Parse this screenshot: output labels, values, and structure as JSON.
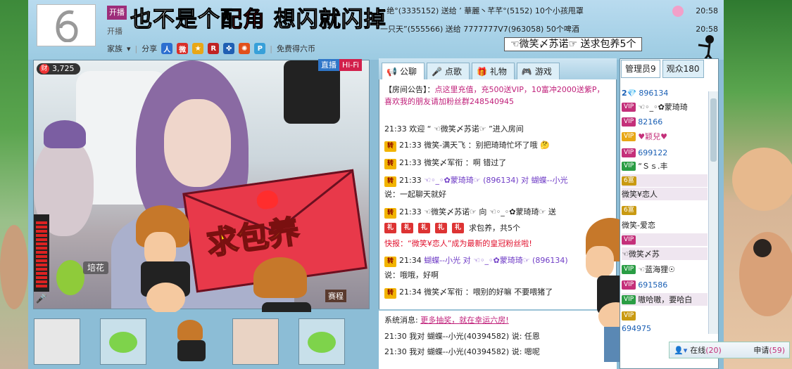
{
  "header": {
    "banner_prefix": "也不是个",
    "banner_red1": "配角",
    "banner_mid": "想闪就闪掉",
    "live_label": "开播",
    "family_label": "家族",
    "share_label": "分享",
    "six_coins_label": "免费得六币"
  },
  "gifts": [
    {
      "text": "−绝°(3335152) 送给 ’ 華麗丶芊芊°(5152) 10个小孩甩罩",
      "time": "20:58"
    },
    {
      "text": "一只天”(555566) 送给 7777777V7(963058) 50个啤酒",
      "time": "20:58"
    }
  ],
  "callout": "☜微笑〆苏诺☞  送求包养5个",
  "video": {
    "wealth_value": "3,725",
    "wealth_badge": "财",
    "live_badge": "直播",
    "hifi_badge": "Hi-Fi",
    "envelope_text": "求包养",
    "flower_label": "培花",
    "match_label": "赛程"
  },
  "chat_tabs": [
    {
      "label": "公聊",
      "icon": "megaphone-icon",
      "active": true
    },
    {
      "label": "点歌",
      "icon": "microphone-icon",
      "active": false
    },
    {
      "label": "礼物",
      "icon": "gift-icon",
      "active": false
    },
    {
      "label": "游戏",
      "icon": "gamepad-icon",
      "active": false
    }
  ],
  "announcement": {
    "prefix": "【房间公告】：",
    "body": "点这里充值，充500送VIP，10富冲2000送紫P，喜欢我的朋友请加粉丝群248540945"
  },
  "chat": [
    {
      "time": "21:33",
      "text": "欢迎 “ ☜微笑〆苏诺☞ ”进入房间",
      "zhuan": false
    },
    {
      "time": "21:33",
      "text": "微笑-满天飞 ：别把琦琦忙坏了哦",
      "zhuan": true
    },
    {
      "time": "21:33",
      "text": "微笑〆军衔 ：啊  错过了",
      "zhuan": true
    },
    {
      "time": "21:33",
      "text": "☜◦_◦✿蒙琦琦☞ (896134) 对 蝴蝶--小光",
      "zhuan": true
    },
    {
      "time": "",
      "text": "说：一起聊天就好",
      "zhuan": false
    },
    {
      "time": "21:33",
      "text": "☜微笑〆苏诺☞ 向 ☜◦_◦✿蒙琦琦☞ 送",
      "zhuan": true
    },
    {
      "time": "",
      "text": "求包养，共5个",
      "zhuan": false
    },
    {
      "time": "",
      "text": "快报：“微笑¥恋人”成为最新的皇冠粉丝啦!",
      "zhuan": false,
      "flash": true
    },
    {
      "time": "21:34",
      "text": "蝴蝶--小光 对 ☜◦_◦✿蒙琦琦☞ (896134)",
      "zhuan": true
    },
    {
      "time": "",
      "text": "说：哦哦，好啊",
      "zhuan": false
    },
    {
      "time": "21:34",
      "text": "微笑〆军衔 ：喂别的好嘛  不要喂猪了",
      "zhuan": true
    }
  ],
  "system": {
    "label": "系统消息:",
    "link": "更多抽奖，就在幸运六房!",
    "lines": [
      "21:30 我对  蝴蝶--小光(40394582) 说: 任恩",
      "21:30 我对  蝴蝶--小光(40394582) 说: 嗯呢"
    ]
  },
  "right_tabs": [
    {
      "label": "管理员9",
      "active": true
    },
    {
      "label": "观众180",
      "active": false
    }
  ],
  "users": [
    {
      "badge": "2💎",
      "name": "896134"
    },
    {
      "badge": "VIP",
      "name": "☜◦_◦✿蒙琦琦"
    },
    {
      "badge": "VIP",
      "name": "82166"
    },
    {
      "badge": "VIP",
      "name": "♥颖兒♥"
    },
    {
      "badge": "VIP",
      "name": "699122"
    },
    {
      "badge": "VIP",
      "name": "“Ｓｓ.丰"
    },
    {
      "badge": "6富",
      "name": "微笑¥恋人"
    },
    {
      "badge": "6富",
      "name": "微笑-爱恋"
    },
    {
      "badge": "VIP",
      "name": "☜微笑〆苏"
    },
    {
      "badge": "VIP",
      "name": "☜蓝海狸☉"
    },
    {
      "badge": "VIP",
      "name": "691586"
    },
    {
      "badge": "VIP",
      "name": "嗷哈嗷，要哈白"
    },
    {
      "badge": "VIP",
      "name": "694975"
    }
  ],
  "footer": {
    "online_label": "在线",
    "online_count": "(20)",
    "apply_label": "申请",
    "apply_count": "(59)"
  }
}
